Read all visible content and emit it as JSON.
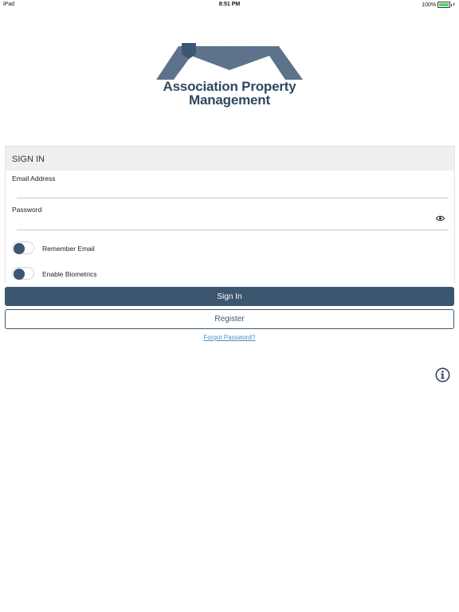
{
  "status_bar": {
    "device": "iPad",
    "time": "8:51 PM",
    "battery_text": "100%",
    "battery_color": "#4cd964"
  },
  "logo": {
    "line1": "Association Property",
    "line2": "Management",
    "brand_color": "#2f4862"
  },
  "signin": {
    "header": "SIGN IN",
    "email_label": "Email Address",
    "email_value": "",
    "password_label": "Password",
    "password_value": "",
    "password_visibility_icon": "eye-icon",
    "remember_email_label": "Remember Email",
    "enable_biometrics_label": "Enable Biometrics",
    "signin_button": "Sign In",
    "register_button": "Register",
    "forgot_link": "Forgot Password?",
    "accent_color": "#3c5670",
    "link_color": "#4a90c8"
  },
  "info_icon": "info-icon"
}
